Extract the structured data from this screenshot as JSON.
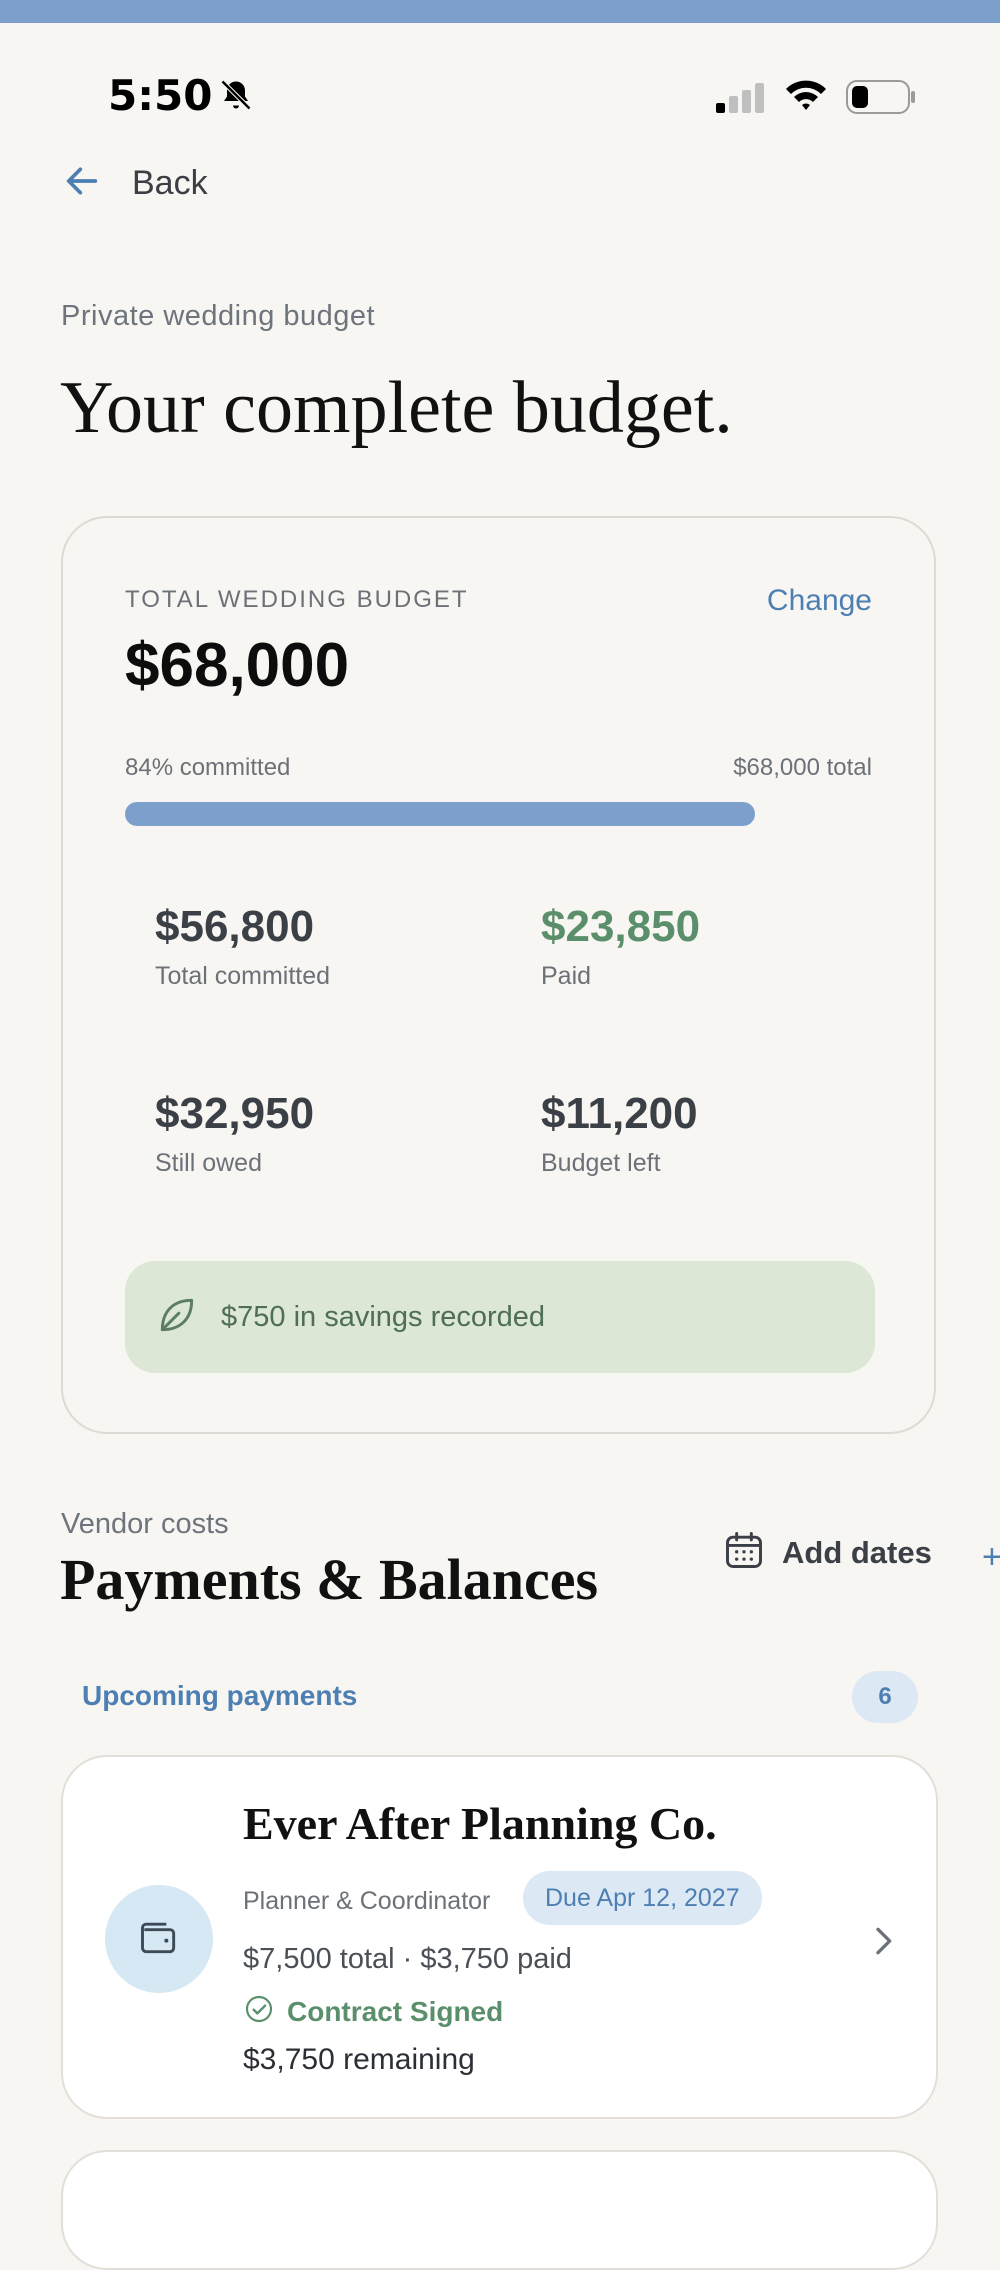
{
  "status_bar": {
    "time": "5:50",
    "icons": [
      "bell-slash-icon",
      "cellular-signal-icon",
      "wifi-icon",
      "battery-icon"
    ]
  },
  "nav": {
    "back_label": "Back",
    "back_icon": "arrow-left-icon"
  },
  "header": {
    "eyebrow": "Private wedding budget",
    "title": "Your complete budget."
  },
  "budget": {
    "caption": "TOTAL WEDDING BUDGET",
    "change_label": "Change",
    "amount": "$68,000",
    "committed_pct_text": "84% committed",
    "total_text": "$68,000 total",
    "progress_fraction": 0.84,
    "stats": [
      {
        "value": "$56,800",
        "label": "Total committed",
        "color": "#3b3f46"
      },
      {
        "value": "$23,850",
        "label": "Paid",
        "color": "#5b8f6b"
      },
      {
        "value": "$32,950",
        "label": "Still owed",
        "color": "#3b3f46"
      },
      {
        "value": "$11,200",
        "label": "Budget left",
        "color": "#3b3f46"
      }
    ],
    "savings_text": "$750 in savings recorded",
    "savings_icon": "leaf-icon"
  },
  "vendors_section": {
    "eyebrow": "Vendor costs",
    "title": "Payments & Balances",
    "add_dates_label": "Add dates",
    "add_dates_icon": "calendar-icon",
    "upcoming_label": "Upcoming payments",
    "upcoming_count": "6"
  },
  "vendor_cards": [
    {
      "name": "Ever After Planning Co.",
      "category": "Planner & Coordinator",
      "due": "Due Apr 12, 2027",
      "money": "$7,500 total · $3,750 paid",
      "contract_status": "Contract Signed",
      "remaining": "$3,750 remaining",
      "icon": "wallet-icon"
    }
  ],
  "colors": {
    "accent": "#4d7fb3",
    "progress": "#7ca0cb",
    "positive": "#5b8f6b",
    "savings_bg": "#dde7d6",
    "background": "#f8f6f2"
  }
}
